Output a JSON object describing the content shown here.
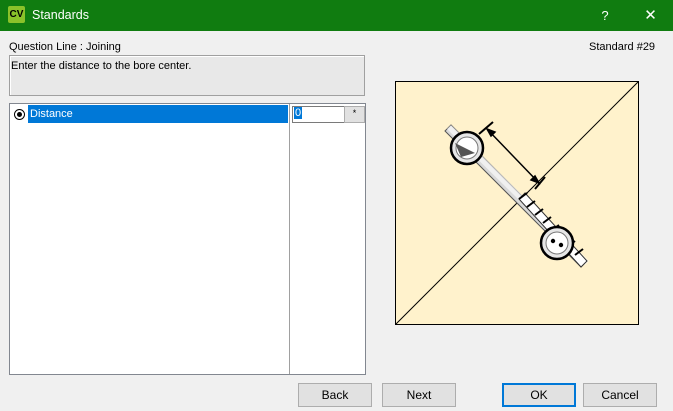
{
  "window": {
    "icon_text": "CV",
    "title": "Standards",
    "help_label": "?",
    "close_label": "✕",
    "accent_color": "#107c10"
  },
  "header": {
    "question_line": "Question Line : Joining",
    "standard": "Standard #29"
  },
  "prompt": {
    "text": "Enter the distance to the bore center."
  },
  "list": {
    "rows": [
      {
        "label": "Distance",
        "value": "0",
        "selected": true
      }
    ]
  },
  "buttons": {
    "back": "Back",
    "next": "Next",
    "ok": "OK",
    "cancel": "Cancel"
  },
  "icons": {
    "dropdown": "*"
  }
}
